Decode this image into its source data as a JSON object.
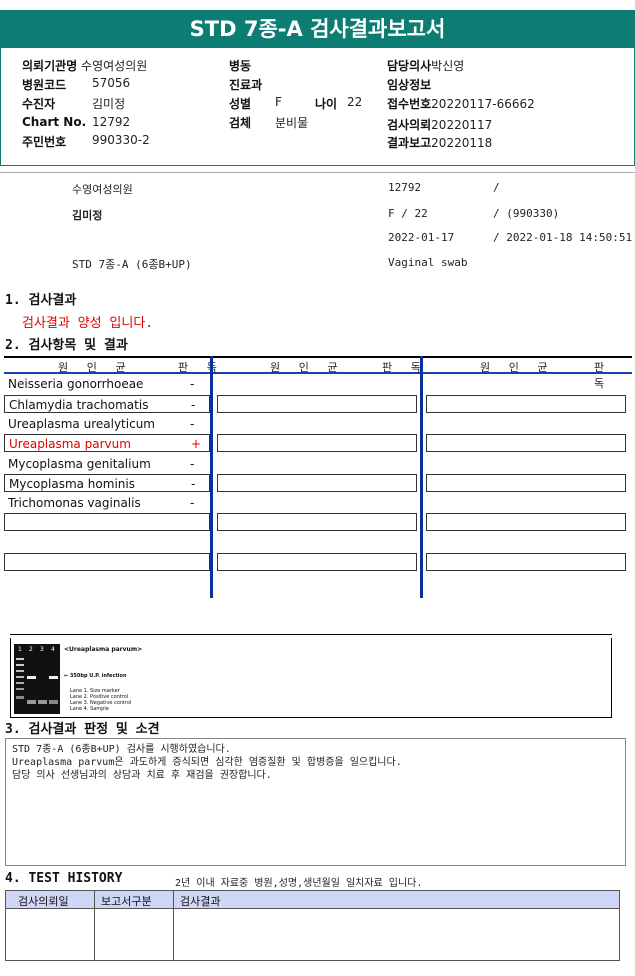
{
  "title": "STD 7종-A 검사결과보고서",
  "info": {
    "institution_label": "의뢰기관명",
    "institution": "수영여성의원",
    "hospital_code_label": "병원코드",
    "hospital_code": "57056",
    "patient_label": "수진자",
    "patient": "김미정",
    "chart_label": "Chart No.",
    "chart": "12792",
    "id_label": "주민번호",
    "id": "990330-2",
    "ward_label": "병동",
    "ward": "",
    "dept_label": "진료과",
    "dept": "",
    "sex_label": "성별",
    "sex": "F",
    "age_label": "나이",
    "age": "22",
    "specimen_label": "검체",
    "specimen": "분비물",
    "doctor_label": "담당의사",
    "doctor": "박신영",
    "clinical_label": "임상정보",
    "clinical": "",
    "receipt_label": "접수번호",
    "receipt": "20220117-66662",
    "request_label": "검사의뢰",
    "request": "20220117",
    "report_label": "결과보고",
    "report": "20220118"
  },
  "summary": {
    "institution": "수영여성의원",
    "chart": "12792",
    "slash1": "/",
    "patient": "김미정",
    "sex_age": "F  /  22",
    "birth": "/ (990330)",
    "request_date": "2022-01-17",
    "report_datetime": "/ 2022-01-18 14:50:51",
    "test_name": "STD 7종-A (6종B+UP)",
    "specimen": "Vaginal swab"
  },
  "section1": {
    "title": "1. 검사결과",
    "result": "검사결과 양성 입니다."
  },
  "section2": {
    "title": "2. 검사항목 및 결과",
    "col_pathogen": "원 인 균",
    "col_judgment": "판 독",
    "rows": [
      {
        "name": "Neisseria gonorrhoeae",
        "result": "-",
        "positive": false
      },
      {
        "name": "Chlamydia trachomatis",
        "result": "-",
        "positive": false
      },
      {
        "name": "Ureaplasma urealyticum",
        "result": "-",
        "positive": false
      },
      {
        "name": "Ureaplasma parvum",
        "result": "+",
        "positive": true
      },
      {
        "name": "Mycoplasma genitalium",
        "result": "-",
        "positive": false
      },
      {
        "name": "Mycoplasma hominis",
        "result": "-",
        "positive": false
      },
      {
        "name": "Trichomonas vaginalis",
        "result": "-",
        "positive": false
      }
    ]
  },
  "gel": {
    "lanes": [
      "1",
      "2",
      "3",
      "4"
    ],
    "title": "<Ureaplasma parvum>",
    "arrow_label": "← 350bp U.P. infection",
    "legend": [
      "Lane 1. Size marker",
      "Lane 2. Positive control",
      "Lane 3. Negative control",
      "Lane 4. Sample"
    ]
  },
  "section3": {
    "title": "3. 검사결과 판정 및 소견",
    "lines": [
      "STD 7종-A (6종B+UP) 검사를 시행하였습니다.",
      "Ureaplasma parvum은 과도하게 증식되면 심각한 염증질환 및 합병증을 일으킵니다.",
      "담당 의사 선생님과의 상담과 치료 후 재검을 권장합니다."
    ]
  },
  "section4": {
    "title": "4. TEST HISTORY",
    "note": "2년 이내 자료중 병원,성명,생년월일 일치자료 입니다.",
    "headers": [
      "검사의뢰일",
      "보고서구분",
      "검사결과"
    ]
  },
  "colors": {
    "header_bg": "#0d7d73",
    "positive": "#e00000",
    "divider": "#0b2f9e",
    "history_head": "#cfd6f5"
  }
}
